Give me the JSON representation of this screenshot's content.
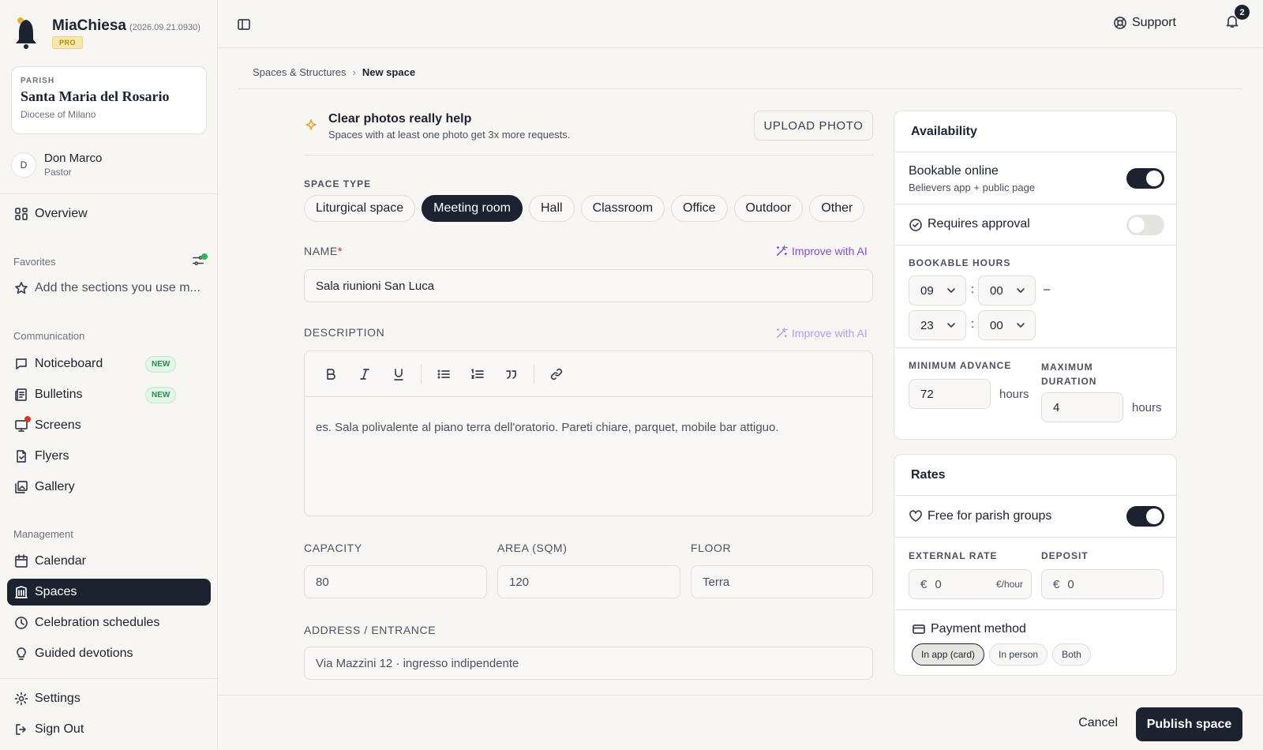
{
  "app": {
    "name": "MiaChiesa",
    "version": "(2026.09.21.0930)",
    "plan": "PRO"
  },
  "parish": {
    "kicker": "PARISH",
    "name": "Santa Maria del Rosario",
    "diocese": "Diocese of Milano"
  },
  "user": {
    "initial": "D",
    "name": "Don Marco",
    "role": "Pastor"
  },
  "sidebar": {
    "overview": "Overview",
    "favorites_label": "Favorites",
    "favorites_hint": "Add the sections you use m...",
    "communication_label": "Communication",
    "communication": [
      {
        "label": "Noticeboard",
        "badge": "NEW"
      },
      {
        "label": "Bulletins",
        "badge": "NEW"
      },
      {
        "label": "Screens"
      },
      {
        "label": "Flyers"
      },
      {
        "label": "Gallery"
      }
    ],
    "management_label": "Management",
    "management": [
      {
        "label": "Calendar"
      },
      {
        "label": "Spaces"
      },
      {
        "label": "Celebration schedules"
      },
      {
        "label": "Guided devotions"
      }
    ],
    "settings": "Settings",
    "signout": "Sign Out"
  },
  "header": {
    "support": "Support",
    "notifications": "2"
  },
  "breadcrumb": {
    "parent": "Spaces & Structures",
    "current": "New space"
  },
  "photo_tip": {
    "title": "Clear photos really help",
    "subtitle": "Spaces with at least one photo get 3x more requests.",
    "button": "UPLOAD PHOTO"
  },
  "form": {
    "space_type_label": "SPACE TYPE",
    "space_types": [
      "Liturgical space",
      "Meeting room",
      "Hall",
      "Classroom",
      "Office",
      "Outdoor",
      "Other"
    ],
    "selected_type": "Meeting room",
    "name_label": "NAME",
    "required_mark": "*",
    "ai_label": "Improve with AI",
    "name_value": "Sala riunioni San Luca",
    "description_label": "DESCRIPTION",
    "description_placeholder": "es. Sala polivalente al piano terra dell'oratorio. Pareti chiare, parquet, mobile bar attiguo.",
    "capacity_label": "CAPACITY",
    "capacity_placeholder": "80",
    "area_label": "AREA (SQM)",
    "area_placeholder": "120",
    "floor_label": "FLOOR",
    "floor_placeholder": "Terra",
    "address_label": "ADDRESS / ENTRANCE",
    "address_placeholder": "Via Mazzini 12 · ingresso indipendente"
  },
  "availability": {
    "title": "Availability",
    "bookable_label": "Bookable online",
    "bookable_sub": "Believers app + public page",
    "bookable_on": true,
    "approval_label": "Requires approval",
    "approval_on": false,
    "hours_label": "BOOKABLE HOURS",
    "from_hour": "09",
    "from_min": "00",
    "to_hour": "23",
    "to_min": "00",
    "colon": ":",
    "dash": "–",
    "min_advance_label": "MINIMUM ADVANCE",
    "min_advance_value": "72",
    "max_duration_label": "MAXIMUM DURATION",
    "max_duration_value": "4",
    "unit": "hours"
  },
  "rates": {
    "title": "Rates",
    "free_label": "Free for parish groups",
    "free_on": true,
    "external_label": "EXTERNAL RATE",
    "currency": "€",
    "external_value": "0",
    "external_unit": "€/hour",
    "deposit_label": "DEPOSIT",
    "deposit_value": "0",
    "payment_label": "Payment method",
    "payment_options": [
      "In app (card)",
      "In person",
      "Both"
    ],
    "payment_selected": "In app (card)"
  },
  "footer": {
    "cancel": "Cancel",
    "publish": "Publish space"
  },
  "colors": {
    "primary": "#1c2230",
    "accent_ai": "#8250d8",
    "bg": "#f7f6f3",
    "new_badge": "#2f8a4b",
    "alert": "#d9362e"
  }
}
